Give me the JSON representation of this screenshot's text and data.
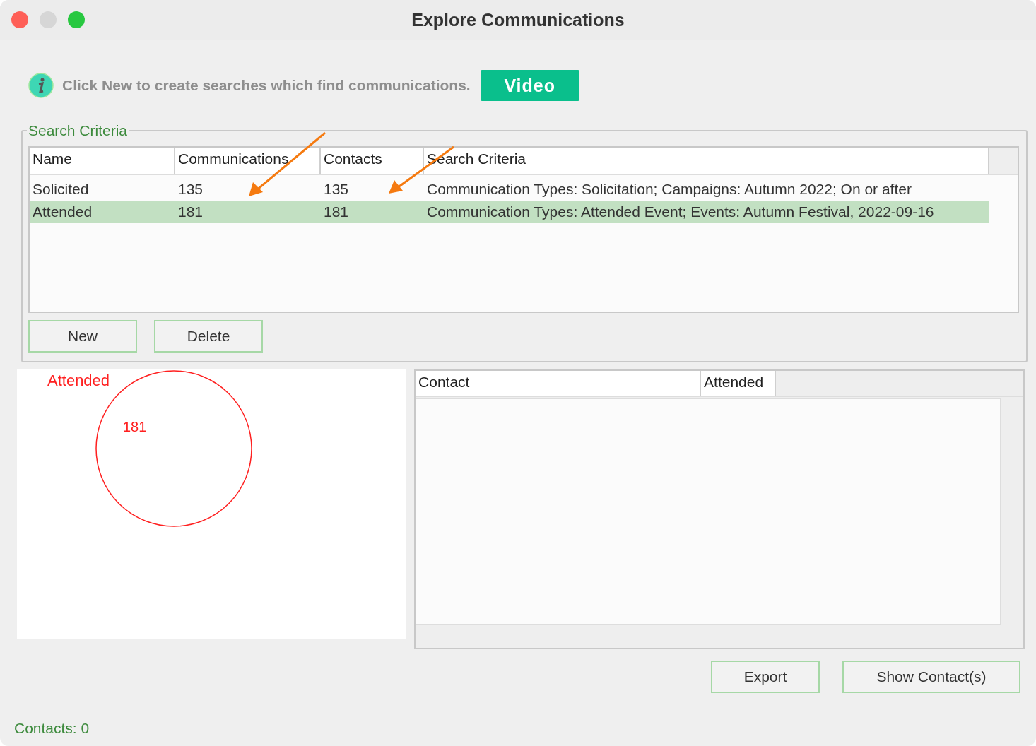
{
  "window": {
    "title": "Explore Communications"
  },
  "info": {
    "text": "Click New to create searches which find communications.",
    "video_button": "Video"
  },
  "search_criteria": {
    "legend": "Search Criteria",
    "columns": [
      "Name",
      "Communications",
      "Contacts",
      "Search Criteria"
    ],
    "rows": [
      {
        "cells": [
          "Solicited",
          "135",
          "135",
          "Communication Types: Solicitation; Campaigns: Autumn 2022; On or after"
        ],
        "selected": false
      },
      {
        "cells": [
          "Attended",
          "181",
          "181",
          "Communication Types: Attended Event; Events: Autumn Festival, 2022-09-16"
        ],
        "selected": true
      }
    ],
    "buttons": [
      "New",
      "Delete"
    ]
  },
  "venn": {
    "label": "Attended",
    "count": "181"
  },
  "contacts_table": {
    "columns": [
      "Contact",
      "Attended"
    ]
  },
  "buttons": [
    "Export",
    "Show Contact(s)"
  ],
  "status_bar": "Contacts: 0"
}
